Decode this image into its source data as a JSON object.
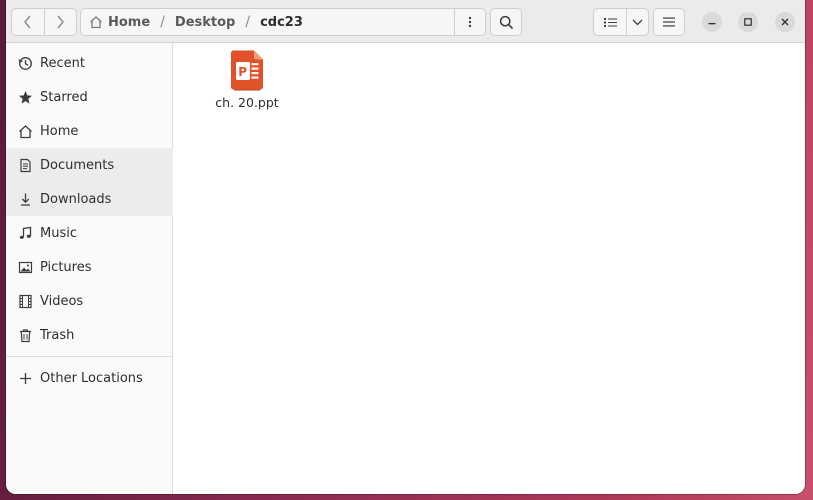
{
  "headerbar": {
    "back_icon": "chevron-left-icon",
    "forward_icon": "chevron-right-icon",
    "breadcrumbs": [
      {
        "label": "Home",
        "icon": "home-icon"
      },
      {
        "label": "Desktop"
      },
      {
        "label": "cdc23"
      }
    ],
    "path_menu_icon": "vertical-dots-icon",
    "search_icon": "search-icon",
    "view_list_icon": "list-view-icon",
    "view_options_icon": "chevron-down-icon",
    "main_menu_icon": "hamburger-menu-icon",
    "window_controls": [
      "minimize",
      "maximize",
      "close"
    ]
  },
  "sidebar": {
    "items": [
      {
        "label": "Recent",
        "icon": "clock-icon"
      },
      {
        "label": "Starred",
        "icon": "star-icon"
      },
      {
        "label": "Home",
        "icon": "home-icon"
      },
      {
        "label": "Documents",
        "icon": "document-icon"
      },
      {
        "label": "Downloads",
        "icon": "download-icon"
      },
      {
        "label": "Music",
        "icon": "music-icon"
      },
      {
        "label": "Pictures",
        "icon": "picture-icon"
      },
      {
        "label": "Videos",
        "icon": "video-icon"
      },
      {
        "label": "Trash",
        "icon": "trash-icon"
      }
    ],
    "other_locations": {
      "label": "Other Locations",
      "icon": "plus-icon"
    }
  },
  "content": {
    "files": [
      {
        "name": "ch. 20.ppt",
        "icon": "powerpoint-file-icon"
      }
    ]
  },
  "colors": {
    "accent_file_icon": "#e0522a",
    "desktop_background": "#8a2a52"
  }
}
